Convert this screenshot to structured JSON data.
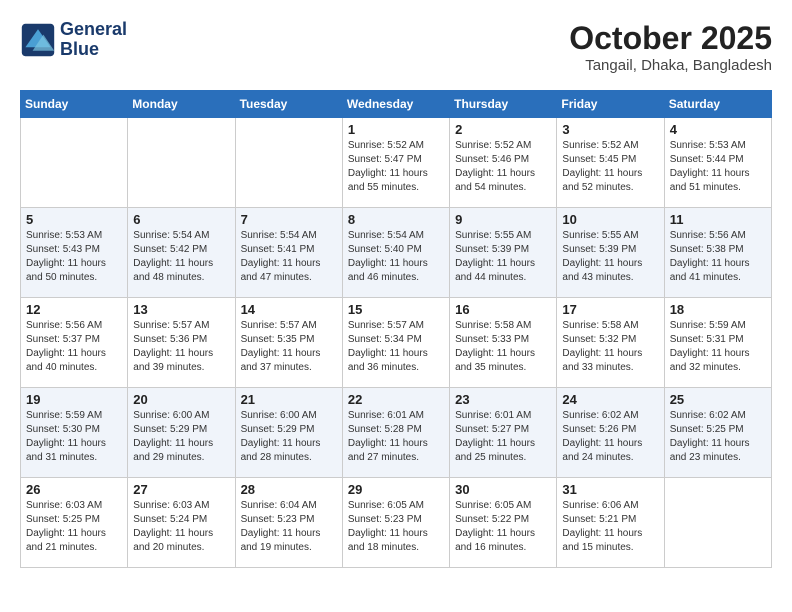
{
  "header": {
    "logo_line1": "General",
    "logo_line2": "Blue",
    "month": "October 2025",
    "location": "Tangail, Dhaka, Bangladesh"
  },
  "weekdays": [
    "Sunday",
    "Monday",
    "Tuesday",
    "Wednesday",
    "Thursday",
    "Friday",
    "Saturday"
  ],
  "weeks": [
    [
      {
        "day": "",
        "text": ""
      },
      {
        "day": "",
        "text": ""
      },
      {
        "day": "",
        "text": ""
      },
      {
        "day": "1",
        "text": "Sunrise: 5:52 AM\nSunset: 5:47 PM\nDaylight: 11 hours and 55 minutes."
      },
      {
        "day": "2",
        "text": "Sunrise: 5:52 AM\nSunset: 5:46 PM\nDaylight: 11 hours and 54 minutes."
      },
      {
        "day": "3",
        "text": "Sunrise: 5:52 AM\nSunset: 5:45 PM\nDaylight: 11 hours and 52 minutes."
      },
      {
        "day": "4",
        "text": "Sunrise: 5:53 AM\nSunset: 5:44 PM\nDaylight: 11 hours and 51 minutes."
      }
    ],
    [
      {
        "day": "5",
        "text": "Sunrise: 5:53 AM\nSunset: 5:43 PM\nDaylight: 11 hours and 50 minutes."
      },
      {
        "day": "6",
        "text": "Sunrise: 5:54 AM\nSunset: 5:42 PM\nDaylight: 11 hours and 48 minutes."
      },
      {
        "day": "7",
        "text": "Sunrise: 5:54 AM\nSunset: 5:41 PM\nDaylight: 11 hours and 47 minutes."
      },
      {
        "day": "8",
        "text": "Sunrise: 5:54 AM\nSunset: 5:40 PM\nDaylight: 11 hours and 46 minutes."
      },
      {
        "day": "9",
        "text": "Sunrise: 5:55 AM\nSunset: 5:39 PM\nDaylight: 11 hours and 44 minutes."
      },
      {
        "day": "10",
        "text": "Sunrise: 5:55 AM\nSunset: 5:39 PM\nDaylight: 11 hours and 43 minutes."
      },
      {
        "day": "11",
        "text": "Sunrise: 5:56 AM\nSunset: 5:38 PM\nDaylight: 11 hours and 41 minutes."
      }
    ],
    [
      {
        "day": "12",
        "text": "Sunrise: 5:56 AM\nSunset: 5:37 PM\nDaylight: 11 hours and 40 minutes."
      },
      {
        "day": "13",
        "text": "Sunrise: 5:57 AM\nSunset: 5:36 PM\nDaylight: 11 hours and 39 minutes."
      },
      {
        "day": "14",
        "text": "Sunrise: 5:57 AM\nSunset: 5:35 PM\nDaylight: 11 hours and 37 minutes."
      },
      {
        "day": "15",
        "text": "Sunrise: 5:57 AM\nSunset: 5:34 PM\nDaylight: 11 hours and 36 minutes."
      },
      {
        "day": "16",
        "text": "Sunrise: 5:58 AM\nSunset: 5:33 PM\nDaylight: 11 hours and 35 minutes."
      },
      {
        "day": "17",
        "text": "Sunrise: 5:58 AM\nSunset: 5:32 PM\nDaylight: 11 hours and 33 minutes."
      },
      {
        "day": "18",
        "text": "Sunrise: 5:59 AM\nSunset: 5:31 PM\nDaylight: 11 hours and 32 minutes."
      }
    ],
    [
      {
        "day": "19",
        "text": "Sunrise: 5:59 AM\nSunset: 5:30 PM\nDaylight: 11 hours and 31 minutes."
      },
      {
        "day": "20",
        "text": "Sunrise: 6:00 AM\nSunset: 5:29 PM\nDaylight: 11 hours and 29 minutes."
      },
      {
        "day": "21",
        "text": "Sunrise: 6:00 AM\nSunset: 5:29 PM\nDaylight: 11 hours and 28 minutes."
      },
      {
        "day": "22",
        "text": "Sunrise: 6:01 AM\nSunset: 5:28 PM\nDaylight: 11 hours and 27 minutes."
      },
      {
        "day": "23",
        "text": "Sunrise: 6:01 AM\nSunset: 5:27 PM\nDaylight: 11 hours and 25 minutes."
      },
      {
        "day": "24",
        "text": "Sunrise: 6:02 AM\nSunset: 5:26 PM\nDaylight: 11 hours and 24 minutes."
      },
      {
        "day": "25",
        "text": "Sunrise: 6:02 AM\nSunset: 5:25 PM\nDaylight: 11 hours and 23 minutes."
      }
    ],
    [
      {
        "day": "26",
        "text": "Sunrise: 6:03 AM\nSunset: 5:25 PM\nDaylight: 11 hours and 21 minutes."
      },
      {
        "day": "27",
        "text": "Sunrise: 6:03 AM\nSunset: 5:24 PM\nDaylight: 11 hours and 20 minutes."
      },
      {
        "day": "28",
        "text": "Sunrise: 6:04 AM\nSunset: 5:23 PM\nDaylight: 11 hours and 19 minutes."
      },
      {
        "day": "29",
        "text": "Sunrise: 6:05 AM\nSunset: 5:23 PM\nDaylight: 11 hours and 18 minutes."
      },
      {
        "day": "30",
        "text": "Sunrise: 6:05 AM\nSunset: 5:22 PM\nDaylight: 11 hours and 16 minutes."
      },
      {
        "day": "31",
        "text": "Sunrise: 6:06 AM\nSunset: 5:21 PM\nDaylight: 11 hours and 15 minutes."
      },
      {
        "day": "",
        "text": ""
      }
    ]
  ]
}
